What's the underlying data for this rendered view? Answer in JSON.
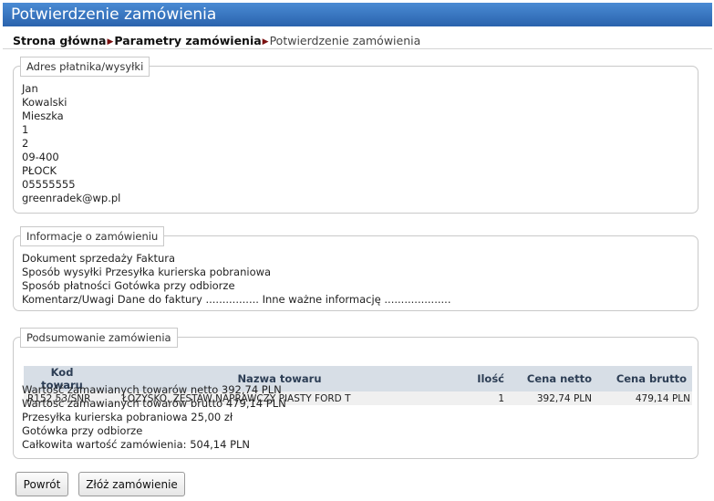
{
  "header": {
    "title": "Potwierdzenie zamówienia"
  },
  "breadcrumb": {
    "items": [
      "Strona główna",
      "Parametry zamówienia",
      "Potwierdzenie zamówienia"
    ],
    "separator": "▶"
  },
  "address": {
    "legend": "Adres płatnika/wysyłki",
    "lines": [
      "Jan",
      "Kowalski",
      "Mieszka",
      "1",
      "2",
      "09-400",
      "PŁOCK",
      "05555555",
      "greenradek@wp.pl"
    ]
  },
  "order_info": {
    "legend": "Informacje o zamówieniu",
    "lines": [
      "Dokument sprzedaży Faktura",
      "Sposób wysyłki Przesyłka kurierska pobraniowa",
      "Sposób płatności Gotówka przy odbiorze",
      "Komentarz/Uwagi Dane do faktury ................ Inne ważne informację ...................."
    ]
  },
  "summary": {
    "legend": "Podsumowanie zamówienia",
    "columns": [
      "Kod towaru",
      "Nazwa towaru",
      "Ilość",
      "Cena netto",
      "Cena brutto"
    ],
    "rows": [
      [
        "R152.53/SNR",
        "ŁOŻYSKO, ZESTAW NAPRAWCZY PIASTY FORD T",
        "1",
        "392,74 PLN",
        "479,14 PLN"
      ]
    ],
    "lines": [
      "Wartość zamawianych towarów netto 392,74 PLN",
      "Wartość zamawianych towarów brutto 479,14 PLN",
      "Przesyłka kurierska pobraniowa 25,00 zł",
      "Gotówka przy odbiorze",
      "Całkowita wartość zamówienia: 504,14 PLN"
    ]
  },
  "buttons": {
    "back_label": "Powrót",
    "submit_label": "Złóż zamówienie"
  },
  "colors": {
    "header_bg": "#2f6cb7",
    "table_header_bg": "#d7dee6",
    "breadcrumb_arrow": "#7a1010"
  }
}
